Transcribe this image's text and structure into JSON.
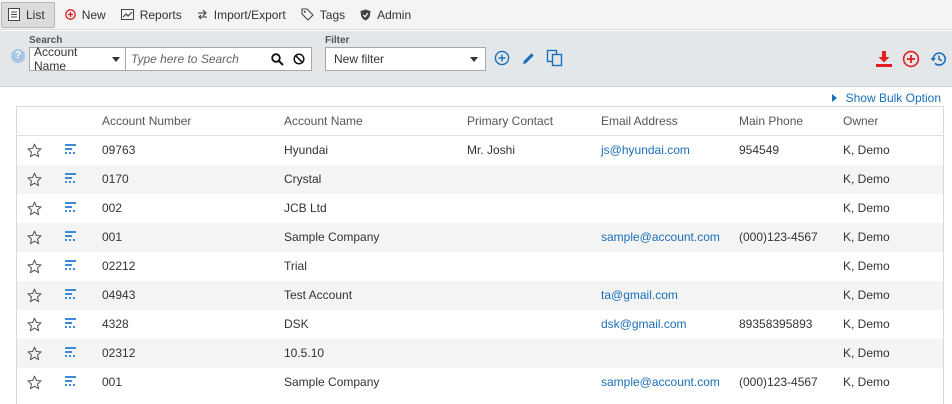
{
  "toolbar": {
    "items": [
      {
        "label": "List",
        "icon": "list-icon"
      },
      {
        "label": "New",
        "icon": "plus-circle-icon"
      },
      {
        "label": "Reports",
        "icon": "chart-icon"
      },
      {
        "label": "Import/Export",
        "icon": "transfer-icon"
      },
      {
        "label": "Tags",
        "icon": "tag-icon"
      },
      {
        "label": "Admin",
        "icon": "shield-icon"
      }
    ]
  },
  "search": {
    "label": "Search",
    "field": "Account Name",
    "placeholder": "Type here to Search"
  },
  "filter": {
    "label": "Filter",
    "selected": "New filter"
  },
  "bulk_option": "Show Bulk Option",
  "table": {
    "columns": [
      "Account Number",
      "Account Name",
      "Primary Contact",
      "Email Address",
      "Main Phone",
      "Owner"
    ],
    "rows": [
      {
        "number": "09763",
        "name": "Hyundai",
        "contact": "Mr. Joshi",
        "email": "js@hyundai.com",
        "phone": "954549",
        "owner": "K, Demo"
      },
      {
        "number": "0170",
        "name": "Crystal",
        "contact": "",
        "email": "",
        "phone": "",
        "owner": "K, Demo"
      },
      {
        "number": "002",
        "name": "JCB Ltd",
        "contact": "",
        "email": "",
        "phone": "",
        "owner": "K, Demo"
      },
      {
        "number": "001",
        "name": "Sample Company",
        "contact": "",
        "email": "sample@account.com",
        "phone": "(000)123-4567",
        "owner": "K, Demo"
      },
      {
        "number": "02212",
        "name": "Trial",
        "contact": "",
        "email": "",
        "phone": "",
        "owner": "K, Demo"
      },
      {
        "number": "04943",
        "name": "Test Account",
        "contact": "",
        "email": "ta@gmail.com",
        "phone": "",
        "owner": "K, Demo"
      },
      {
        "number": "4328",
        "name": "DSK",
        "contact": "",
        "email": "dsk@gmail.com",
        "phone": "89358395893",
        "owner": "K, Demo"
      },
      {
        "number": "02312",
        "name": "10.5.10",
        "contact": "",
        "email": "",
        "phone": "",
        "owner": "K, Demo"
      },
      {
        "number": "001",
        "name": "Sample Company",
        "contact": "",
        "email": "sample@account.com",
        "phone": "(000)123-4567",
        "owner": "K, Demo"
      }
    ]
  },
  "colors": {
    "accent_blue": "#1a6fb8",
    "action_red": "#e02020",
    "toolbar_bg": "#f4f4f4",
    "searchbar_bg": "#e4e7ea"
  }
}
